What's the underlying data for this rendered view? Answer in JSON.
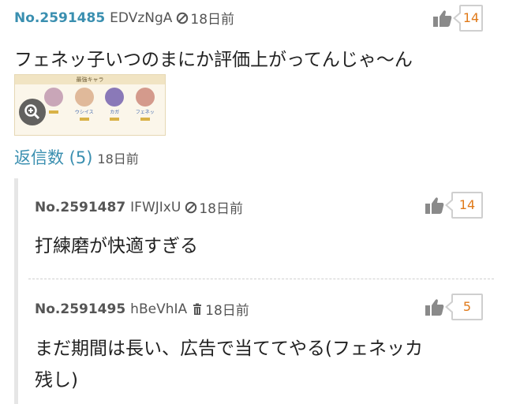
{
  "main_post": {
    "post_no": "No.2591485",
    "user_id": "EDVzNgA",
    "time": "18日前",
    "likes": "14",
    "text": "フェネッ子いつのまにか評価上がってんじゃ〜ん",
    "thumbnail": {
      "header": "最強キャラ",
      "characters": [
        "",
        "ウシイス",
        "カガ",
        "フェネッ"
      ]
    }
  },
  "replies_toggle": {
    "label": "返信数 (5)",
    "time": "18日前"
  },
  "replies": [
    {
      "post_no": "No.2591487",
      "user_id": "IFWJIxU",
      "time": "18日前",
      "likes": "14",
      "text": "打練磨が快適すぎる"
    },
    {
      "post_no": "No.2591495",
      "user_id": "hBeVhIA",
      "time": "18日前",
      "likes": "5",
      "text_line1": "まだ期間は長い、広告で当ててやる(フェネッカ",
      "text_line2": "残し)"
    }
  ],
  "colors": {
    "link_blue": "#3a8fb0",
    "like_orange": "#e07a1a",
    "icon_gray": "#8a8a8a"
  }
}
